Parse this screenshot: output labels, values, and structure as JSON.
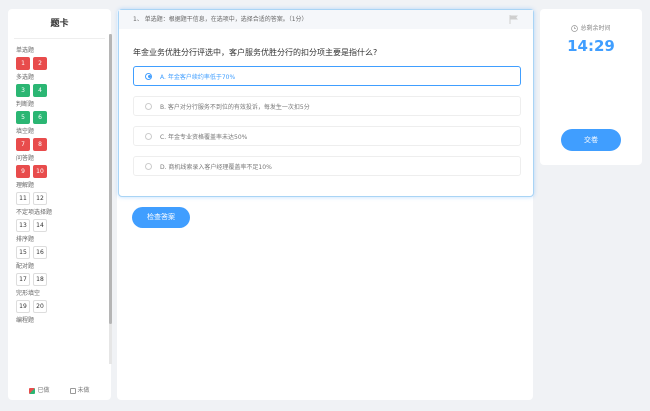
{
  "answer_card": {
    "title": "题卡",
    "groups": [
      {
        "label": "单选题",
        "items": [
          {
            "num": "1",
            "state": "red"
          },
          {
            "num": "2",
            "state": "red"
          }
        ]
      },
      {
        "label": "多选题",
        "items": [
          {
            "num": "3",
            "state": "green"
          },
          {
            "num": "4",
            "state": "green"
          }
        ]
      },
      {
        "label": "判断题",
        "items": [
          {
            "num": "5",
            "state": "green"
          },
          {
            "num": "6",
            "state": "green"
          }
        ]
      },
      {
        "label": "填空题",
        "items": [
          {
            "num": "7",
            "state": "red"
          },
          {
            "num": "8",
            "state": "red"
          }
        ]
      },
      {
        "label": "问答题",
        "items": [
          {
            "num": "9",
            "state": "red"
          },
          {
            "num": "10",
            "state": "red"
          }
        ]
      },
      {
        "label": "理解题",
        "items": [
          {
            "num": "11",
            "state": "none"
          },
          {
            "num": "12",
            "state": "none"
          }
        ]
      },
      {
        "label": "不定项选择题",
        "items": [
          {
            "num": "13",
            "state": "none"
          },
          {
            "num": "14",
            "state": "none"
          }
        ]
      },
      {
        "label": "排序题",
        "items": [
          {
            "num": "15",
            "state": "none"
          },
          {
            "num": "16",
            "state": "none"
          }
        ]
      },
      {
        "label": "配对题",
        "items": [
          {
            "num": "17",
            "state": "none"
          },
          {
            "num": "18",
            "state": "none"
          }
        ]
      },
      {
        "label": "完形填空",
        "items": [
          {
            "num": "19",
            "state": "none"
          },
          {
            "num": "20",
            "state": "none"
          }
        ]
      },
      {
        "label": "编程题",
        "items": []
      }
    ],
    "legend_done": "已做",
    "legend_todo": "未做"
  },
  "question": {
    "header": "1、 单选题：根据题干信息，在选项中，选择合适的答案。（1分）",
    "stem": "年金业务优胜分行评选中，客户服务优胜分行的扣分项主要是指什么?",
    "options": [
      {
        "label": "A. 年金客户续约率低于70%",
        "selected": true
      },
      {
        "label": "B. 客户对分行服务不到位的有效投诉，每发生一次扣5分",
        "selected": false
      },
      {
        "label": "C. 年金专业资格覆盖率未达50%",
        "selected": false
      },
      {
        "label": "D. 商机线索录入客户经理覆盖率不足10%",
        "selected": false
      }
    ],
    "check_button": "检查答案"
  },
  "timer": {
    "label": "总剩余时间",
    "value": "14:29",
    "submit_button": "交卷"
  },
  "colors": {
    "accent": "#409eff",
    "wrong": "#e84c4c",
    "correct": "#2bb673"
  }
}
